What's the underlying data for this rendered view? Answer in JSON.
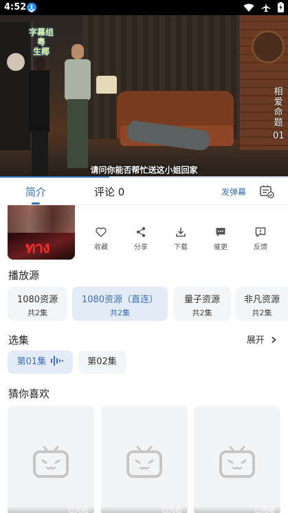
{
  "status_bar": {
    "time": "4:52"
  },
  "video": {
    "watermark_lines": [
      "字幕组",
      "粤",
      "生椰"
    ],
    "title_vertical": [
      "相",
      "爱",
      "命",
      "题",
      "01"
    ],
    "subtitle": "请问你能否帮忙送这小姐回家",
    "progress_percent": 38
  },
  "tabs": {
    "intro": "简介",
    "comments": "评论 0",
    "danmu_button": "发弹幕"
  },
  "poster_text": "ทาง",
  "actions": [
    {
      "label": "收藏",
      "icon": "heart-icon"
    },
    {
      "label": "分享",
      "icon": "share-icon"
    },
    {
      "label": "下载",
      "icon": "download-icon"
    },
    {
      "label": "催更",
      "icon": "chat-dots-icon"
    },
    {
      "label": "反馈",
      "icon": "alert-icon"
    }
  ],
  "sources_section": {
    "title": "播放源",
    "items": [
      {
        "name": "1080资源",
        "count": "共2集",
        "active": false
      },
      {
        "name": "1080资源（直连）",
        "count": "共2集",
        "active": true
      },
      {
        "name": "量子资源",
        "count": "共2集",
        "active": false
      },
      {
        "name": "非凡资源",
        "count": "共2集",
        "active": false
      }
    ]
  },
  "episodes_section": {
    "title": "选集",
    "expand_label": "展开",
    "items": [
      {
        "label": "第01集",
        "active": true
      },
      {
        "label": "第02集",
        "active": false
      }
    ]
  },
  "recommend_section": {
    "title": "猜你喜欢",
    "cards": [
      {
        "status": "已完结"
      },
      {
        "status": "已完结"
      },
      {
        "status": "已完结"
      }
    ]
  },
  "colors": {
    "accent": "#3b6fb6",
    "active_bg": "#e3ebf7",
    "chip_bg": "#f4f5f7"
  }
}
